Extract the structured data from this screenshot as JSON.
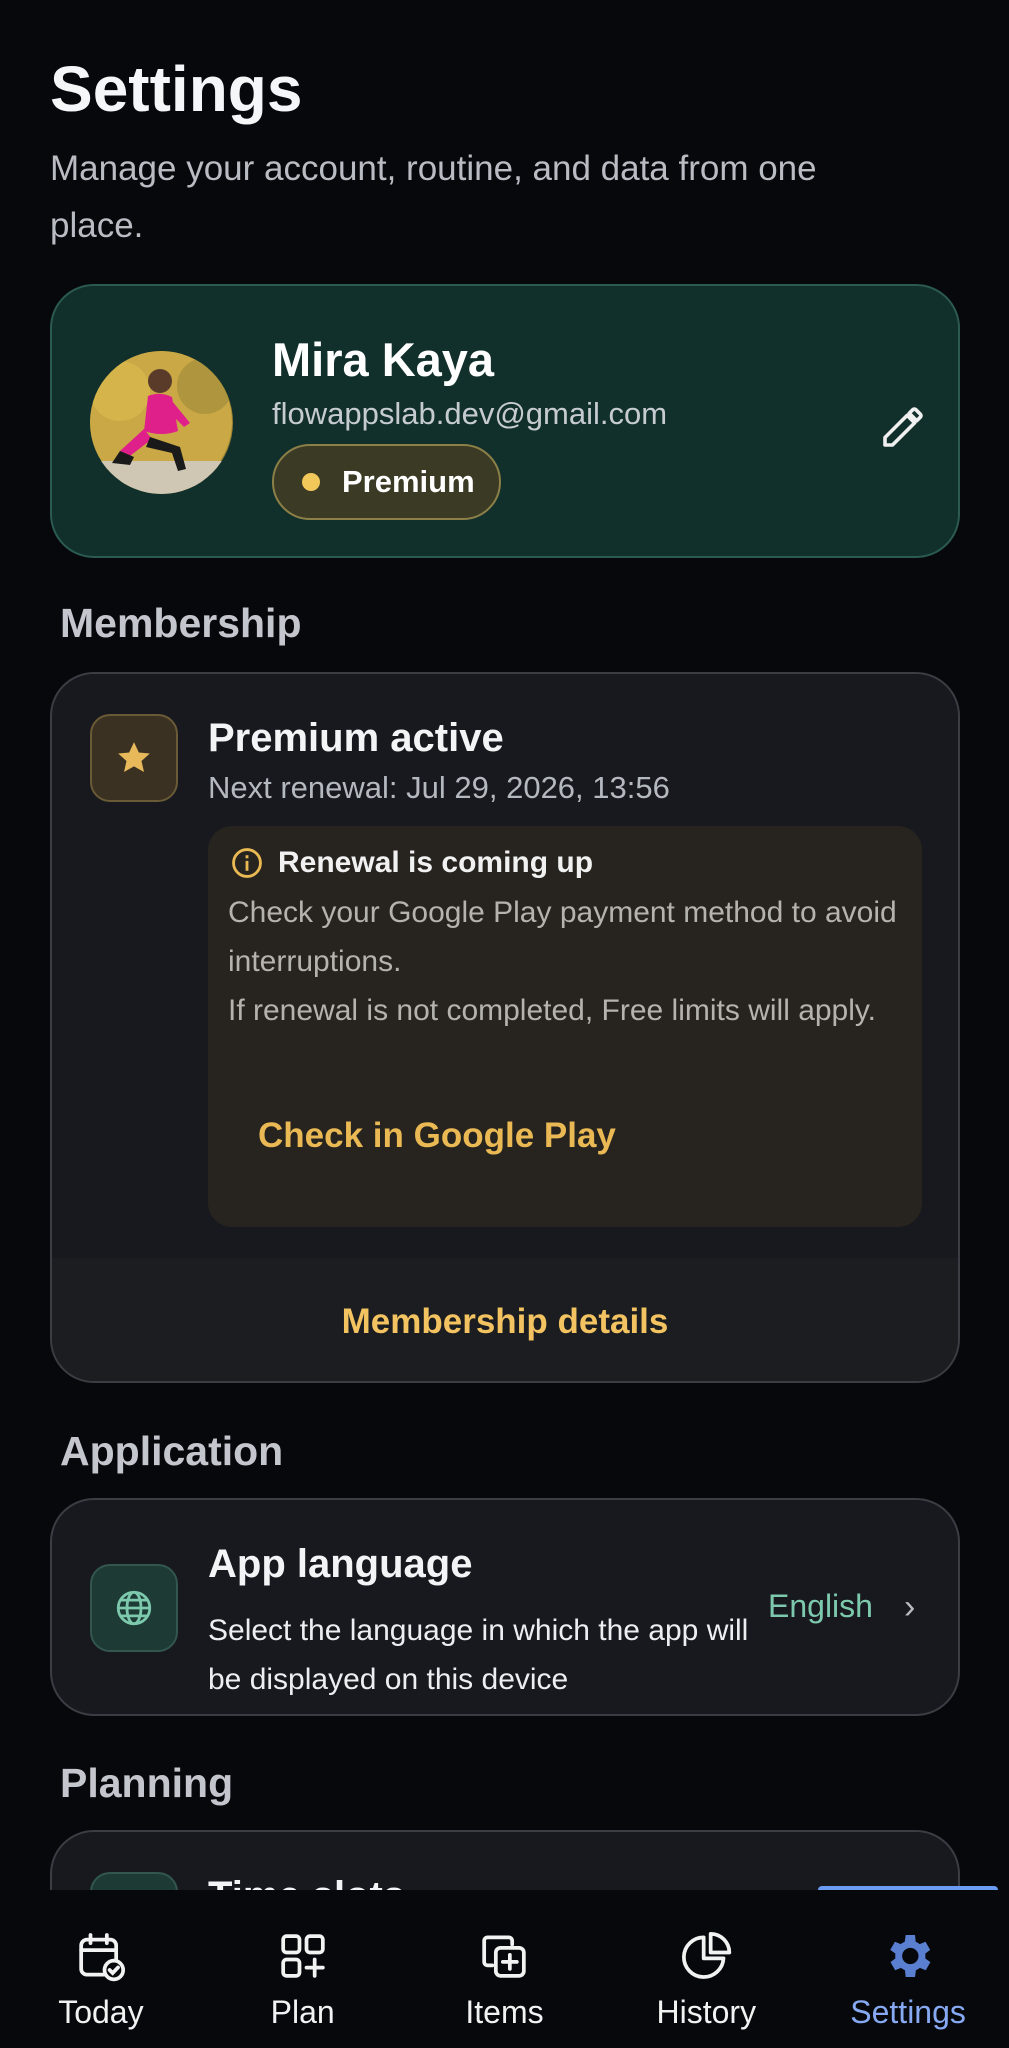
{
  "header": {
    "title": "Settings",
    "subtitle": "Manage your account, routine, and data from one place."
  },
  "profile": {
    "name": "Mira Kaya",
    "email": "flowappslab.dev@gmail.com",
    "badge": "Premium",
    "edit_icon": "pencil-icon"
  },
  "membership": {
    "section_title": "Membership",
    "status_title": "Premium active",
    "renewal_date": "Next renewal: Jul 29, 2026, 13:56",
    "notice": {
      "title": "Renewal is coming up",
      "line1": "Check your Google Play payment method to avoid interruptions.",
      "line2": "If renewal is not completed, Free limits will apply.",
      "action": "Check in Google Play"
    },
    "details_link": "Membership details"
  },
  "application": {
    "section_title": "Application",
    "language": {
      "title": "App language",
      "description": "Select the language in which the app will be displayed on this device",
      "value": "English"
    }
  },
  "planning": {
    "section_title": "Planning",
    "first_item_title": "Time slots"
  },
  "bottom_nav": {
    "items": [
      {
        "label": "Today",
        "icon": "calendar-check-icon"
      },
      {
        "label": "Plan",
        "icon": "grid-plus-icon"
      },
      {
        "label": "Items",
        "icon": "squares-plus-icon"
      },
      {
        "label": "History",
        "icon": "pie-chart-icon"
      },
      {
        "label": "Settings",
        "icon": "gear-icon"
      }
    ],
    "active": "Settings"
  },
  "colors": {
    "background": "#07080c",
    "accent_gold": "#f2c360",
    "accent_green": "#7dc9ad",
    "accent_blue": "#86a9f2"
  }
}
